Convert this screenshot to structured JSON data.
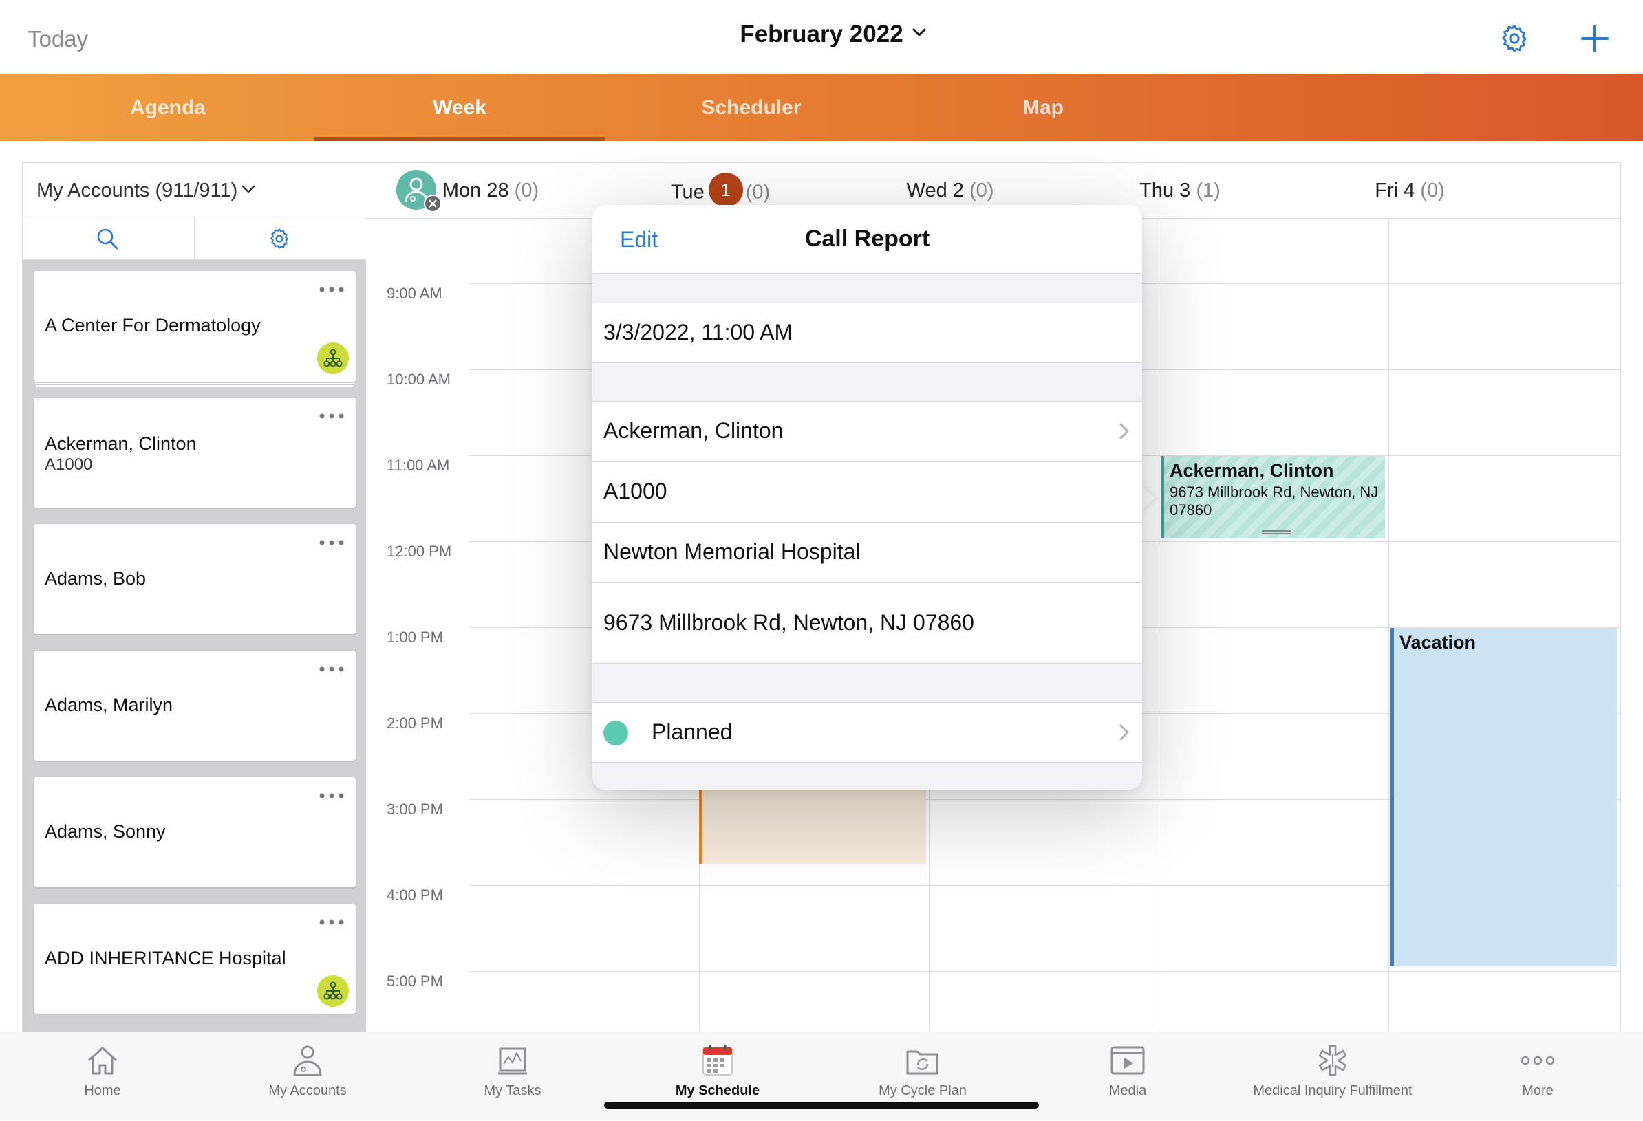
{
  "topbar": {
    "today_label": "Today",
    "month_title": "February 2022",
    "month_chevron_icon": "chevron-down-icon",
    "settings_icon": "gear-icon",
    "add_icon": "plus-icon",
    "accent_color": "#2d7ad6"
  },
  "tabs": [
    {
      "label": "Agenda",
      "active": false
    },
    {
      "label": "Week",
      "active": true
    },
    {
      "label": "Scheduler",
      "active": false
    },
    {
      "label": "Map",
      "active": false
    }
  ],
  "sidebar": {
    "account_selector": "My Accounts (911/911)",
    "accounts": [
      {
        "name": "A Center For Dermatology",
        "id": "",
        "badge": true
      },
      {
        "name": "Ackerman, Clinton",
        "id": "A1000",
        "badge": false
      },
      {
        "name": "Adams, Bob",
        "id": "",
        "badge": false
      },
      {
        "name": "Adams, Marilyn",
        "id": "",
        "badge": false
      },
      {
        "name": "Adams, Sonny",
        "id": "",
        "badge": false
      },
      {
        "name": "ADD INHERITANCE Hospital",
        "id": "",
        "badge": true
      }
    ]
  },
  "calendar": {
    "days": [
      {
        "label": "Mon 28",
        "count": "(0)"
      },
      {
        "label": "Tue",
        "badge": "1",
        "count": "(0)"
      },
      {
        "label": "Wed 2",
        "count": "(0)"
      },
      {
        "label": "Thu 3",
        "count": "(1)"
      },
      {
        "label": "Fri 4",
        "count": "(0)"
      }
    ],
    "times": [
      "9:00 AM",
      "10:00 AM",
      "11:00 AM",
      "12:00 PM",
      "1:00 PM",
      "2:00 PM",
      "3:00 PM",
      "4:00 PM",
      "5:00 PM"
    ],
    "events": {
      "thu_call": {
        "title": "Ackerman, Clinton",
        "address": "9673 Millbrook Rd, Newton, NJ 07860",
        "color": "#3da391"
      },
      "fri_vacation": {
        "title": "Vacation",
        "color": "#3d7cc9"
      },
      "tue_event": {
        "color": "#e0892e"
      }
    }
  },
  "popover": {
    "edit_label": "Edit",
    "title": "Call Report",
    "datetime": "3/3/2022, 11:00 AM",
    "account_name": "Ackerman, Clinton",
    "account_id": "A1000",
    "location": "Newton Memorial Hospital",
    "address": "9673 Millbrook Rd, Newton, NJ 07860",
    "status": "Planned",
    "status_color": "#5cc9b3"
  },
  "bottom_nav": [
    {
      "label": "Home",
      "icon": "home-icon",
      "active": false
    },
    {
      "label": "My Accounts",
      "icon": "accounts-icon",
      "active": false
    },
    {
      "label": "My Tasks",
      "icon": "tasks-icon",
      "active": false
    },
    {
      "label": "My Schedule",
      "icon": "calendar-icon",
      "active": true
    },
    {
      "label": "My Cycle Plan",
      "icon": "cycle-plan-icon",
      "active": false
    },
    {
      "label": "Media",
      "icon": "media-icon",
      "active": false
    },
    {
      "label": "Medical Inquiry Fulfillment",
      "icon": "medical-icon",
      "active": false
    },
    {
      "label": "More",
      "icon": "more-icon",
      "active": false
    }
  ]
}
